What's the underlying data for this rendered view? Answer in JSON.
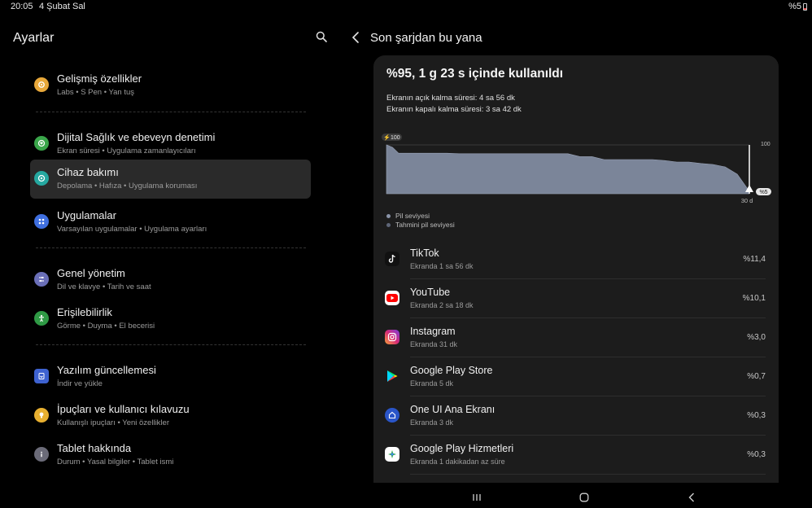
{
  "status": {
    "time": "20:05",
    "date": "4 Şubat Sal",
    "battery": "%5"
  },
  "left": {
    "title": "Ayarlar",
    "items": [
      {
        "title": "Gelişmiş özellikler",
        "sub": "Labs  •  S Pen  •  Yan tuş",
        "icon": "star-gear-icon",
        "color": "#e8a83a"
      },
      {
        "title": "Dijital Sağlık ve ebeveyn denetimi",
        "sub": "Ekran süresi  •  Uygulama zamanlayıcıları",
        "icon": "heart-circle-icon",
        "color": "#3aa64a"
      },
      {
        "title": "Cihaz bakımı",
        "sub": "Depolama  •  Hafıza  •  Uygulama koruması",
        "icon": "device-care-icon",
        "color": "#25a8a0"
      },
      {
        "title": "Uygulamalar",
        "sub": "Varsayılan uygulamalar  •  Uygulama ayarları",
        "icon": "apps-grid-icon",
        "color": "#3f6fe0"
      },
      {
        "title": "Genel yönetim",
        "sub": "Dil ve klavye  •  Tarih ve saat",
        "icon": "sliders-icon",
        "color": "#6a6fb8"
      },
      {
        "title": "Erişilebilirlik",
        "sub": "Görme  •  Duyma  •  El becerisi",
        "icon": "accessibility-icon",
        "color": "#2f9a45"
      },
      {
        "title": "Yazılım güncellemesi",
        "sub": "İndir ve yükle",
        "icon": "update-icon",
        "color": "#3e62d0"
      },
      {
        "title": "İpuçları ve kullanıcı kılavuzu",
        "sub": "Kullanışlı ipuçları  •  Yeni özellikler",
        "icon": "lightbulb-icon",
        "color": "#e8b030"
      },
      {
        "title": "Tablet hakkında",
        "sub": "Durum  •  Yasal bilgiler  •  Tablet ismi",
        "icon": "info-icon",
        "color": "#6b6b78"
      }
    ]
  },
  "right": {
    "title": "Son şarjdan bu yana",
    "usage_title": "%95, 1 g 23 s içinde kullanıldı",
    "screen_on": "Ekranın açık kalma süresi: 4 sa 56 dk",
    "screen_off": "Ekranın kapalı kalma süresi: 3 sa 42 dk",
    "legend": [
      {
        "label": "Pil seviyesi",
        "color": "#8a94a8"
      },
      {
        "label": "Tahmini pil seviyesi",
        "color": "#5e6678"
      }
    ],
    "apps": [
      {
        "name": "TikTok",
        "time": "Ekranda 1 sa 56 dk",
        "pct": "%11,4",
        "icon": "tiktok-icon",
        "color": "#111111"
      },
      {
        "name": "YouTube",
        "time": "Ekranda 2 sa 18 dk",
        "pct": "%10,1",
        "icon": "youtube-icon",
        "color": "#ff0000"
      },
      {
        "name": "Instagram",
        "time": "Ekranda 31 dk",
        "pct": "%3,0",
        "icon": "instagram-icon",
        "color": "#d62976"
      },
      {
        "name": "Google Play Store",
        "time": "Ekranda 5 dk",
        "pct": "%0,7",
        "icon": "play-store-icon",
        "color": "#1c1c1c"
      },
      {
        "name": "One UI Ana Ekranı",
        "time": "Ekranda 3 dk",
        "pct": "%0,3",
        "icon": "home-launcher-icon",
        "color": "#2a55c8"
      },
      {
        "name": "Google Play Hizmetleri",
        "time": "Ekranda 1 dakikadan az süre",
        "pct": "%0,3",
        "icon": "play-services-icon",
        "color": "#ffffff"
      }
    ]
  },
  "chart_data": {
    "type": "area",
    "x": [
      0,
      0.5,
      1,
      2,
      3,
      4,
      5,
      6,
      7,
      8,
      9,
      10,
      11,
      12,
      13,
      14,
      15,
      16,
      17,
      18,
      19,
      20,
      21,
      22,
      23,
      24,
      25,
      26,
      27,
      28,
      29,
      30
    ],
    "values": [
      100,
      95,
      83,
      83,
      83,
      83,
      83,
      82,
      82,
      82,
      82,
      82,
      82,
      82,
      82,
      82,
      82,
      76,
      76,
      70,
      70,
      70,
      70,
      70,
      68,
      65,
      65,
      62,
      60,
      55,
      40,
      5
    ],
    "start_label": "100",
    "end_label": "%5",
    "ytick_label": "100",
    "xtick_label": "30 d",
    "ylim": [
      0,
      100
    ]
  }
}
